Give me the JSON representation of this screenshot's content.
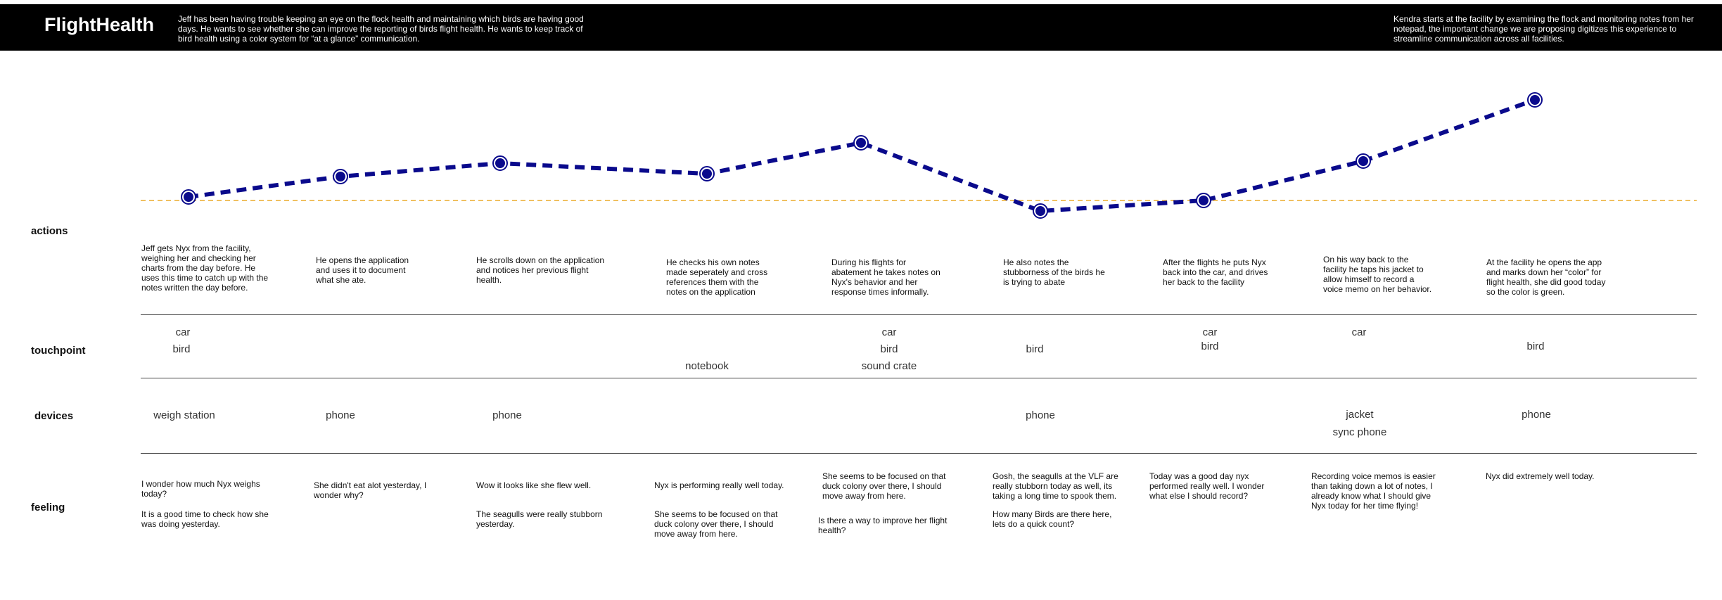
{
  "header": {
    "logo": "FlightHealth",
    "persona_intro": "Jeff has been having trouble keeping an eye on the flock health and maintaining which birds are having good days. He wants to see whether she can improve the reporting of birds flight health. He wants to keep track of bird health using a color system for “at a glance” communication.",
    "proposal": "Kendra starts at the facility by examining the flock and monitoring notes from her notepad, the important change we are proposing digitizes this experience to streamline communication across all facilities."
  },
  "colors": {
    "line": "#0a0a8c",
    "baseline": "#f0c060",
    "banner": "#000000"
  },
  "rows": {
    "actions": "actions",
    "touchpoint": "touchpoint",
    "devices": "devices",
    "feeling": "feeling"
  },
  "journey": {
    "emotion_levels": [
      0.05,
      0.34,
      0.53,
      0.38,
      0.82,
      -0.15,
      0.0,
      0.56,
      1.43
    ],
    "steps": [
      {
        "action": "Jeff gets Nyx from the facility, weighing her and checking her charts from the day before. He uses this time to catch up with the notes written the day before.",
        "touchpoints": [
          "car",
          "bird"
        ],
        "devices": [
          "weigh station"
        ],
        "feelings": [
          "I wonder how much Nyx weighs today?",
          "It is a good time to check how she was doing yesterday."
        ]
      },
      {
        "action": "He opens the application and uses it to document what she ate.",
        "touchpoints": [],
        "devices": [
          "phone"
        ],
        "feelings": [
          "She didn't eat alot yesterday, I wonder why?"
        ]
      },
      {
        "action": "He scrolls down on the application and notices her previous flight health.",
        "touchpoints": [],
        "devices": [
          "phone"
        ],
        "feelings": [
          "Wow it looks like she flew well.",
          "The seagulls were really stubborn yesterday."
        ]
      },
      {
        "action": "He checks his own notes made seperately and cross references them with the notes on the application",
        "touchpoints": [
          "notebook"
        ],
        "devices": [],
        "feelings": [
          "Nyx is performing really well today.",
          "She seems to be focused on that duck colony over there, I should move away from here."
        ]
      },
      {
        "action": "During his flights for abatement he takes notes on Nyx's behavior and her response times informally.",
        "touchpoints": [
          "car",
          "bird",
          "sound crate"
        ],
        "devices": [],
        "feelings": [
          "She seems to be focused on that duck colony over there, I should move away from here.",
          "Is there a way to improve her flight health?"
        ]
      },
      {
        "action": "He also notes the stubborness of the birds he is trying to abate",
        "touchpoints": [
          "bird"
        ],
        "devices": [
          "phone"
        ],
        "feelings": [
          "Gosh, the seagulls at the VLF are really stubborn today as well, its taking a long time to spook them.",
          "How many Birds are there here, lets do a quick count?"
        ]
      },
      {
        "action": "After the flights he puts Nyx back into the car, and drives her back to the facility",
        "touchpoints": [
          "car",
          "bird"
        ],
        "devices": [],
        "feelings": [
          "Today was a good day nyx performed really well. I wonder what else I should record?"
        ]
      },
      {
        "action": "On his way back to the facility he taps his jacket to allow himself to record a voice memo on her behavior.",
        "touchpoints": [
          "car"
        ],
        "devices": [
          "jacket",
          "sync phone"
        ],
        "feelings": [
          "Recording voice memos is easier than taking down a lot of notes, I already know what I should give Nyx today for her time flying!"
        ]
      },
      {
        "action": "At the facility he opens the app and marks down her “color” for flight health, she did good today so the color is green.",
        "touchpoints": [
          "bird"
        ],
        "devices": [
          "phone"
        ],
        "feelings": [
          "Nyx did extremely well today."
        ]
      }
    ]
  }
}
